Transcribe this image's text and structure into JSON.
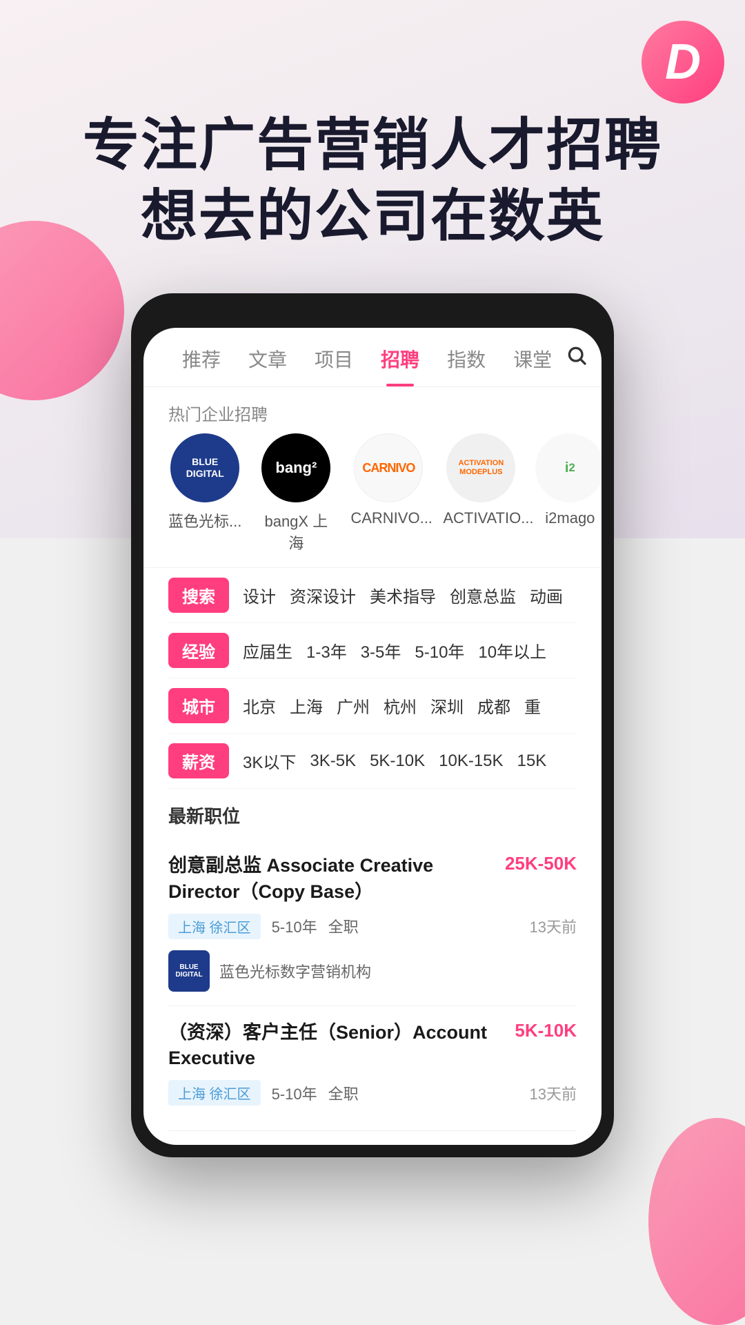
{
  "app": {
    "logo_letter": "D",
    "hero_title_line1": "专注广告营销人才招聘",
    "hero_title_line2": "想去的公司在数英"
  },
  "nav": {
    "items": [
      {
        "id": "recommend",
        "label": "推荐",
        "active": false
      },
      {
        "id": "article",
        "label": "文章",
        "active": false
      },
      {
        "id": "project",
        "label": "项目",
        "active": false
      },
      {
        "id": "recruit",
        "label": "招聘",
        "active": true
      },
      {
        "id": "index",
        "label": "指数",
        "active": false
      },
      {
        "id": "course",
        "label": "课堂",
        "active": false
      }
    ],
    "search_icon": "🔍"
  },
  "hot_companies": {
    "section_label": "热门企业招聘",
    "items": [
      {
        "id": "blue-digital",
        "name": "蓝色光标...",
        "logo_text": "BLUE\nDIGITAL",
        "bg": "#1e3a8a",
        "color": "#fff"
      },
      {
        "id": "bangx",
        "name": "bangX 上海",
        "logo_text": "bang²",
        "bg": "#000",
        "color": "#fff"
      },
      {
        "id": "carnivo",
        "name": "CARNIVO...",
        "logo_text": "CARNIVO",
        "bg": "#fff8f5",
        "color": "#ff6600"
      },
      {
        "id": "activation",
        "name": "ACTIVATIO...",
        "logo_text": "ACTIVATION\nMODEPLUS",
        "bg": "#f0f0f0",
        "color": "#ff6600"
      },
      {
        "id": "i2mago",
        "name": "i2mago",
        "logo_text": "i²",
        "bg": "#f8f8f8",
        "color": "#4CAF50"
      }
    ]
  },
  "filters": [
    {
      "tag": "搜索",
      "options": [
        "设计",
        "资深设计",
        "美术指导",
        "创意总监",
        "动画"
      ]
    },
    {
      "tag": "经验",
      "options": [
        "应届生",
        "1-3年",
        "3-5年",
        "5-10年",
        "10年以上"
      ]
    },
    {
      "tag": "城市",
      "options": [
        "北京",
        "上海",
        "广州",
        "杭州",
        "深圳",
        "成都",
        "重"
      ]
    },
    {
      "tag": "薪资",
      "options": [
        "3K以下",
        "3K-5K",
        "5K-10K",
        "10K-15K",
        "15K"
      ]
    }
  ],
  "jobs": {
    "section_label": "最新职位",
    "items": [
      {
        "id": "job1",
        "title": "创意副总监 Associate Creative Director（Copy Base）",
        "salary": "25K-50K",
        "location": "上海 徐汇区",
        "experience": "5-10年",
        "type": "全职",
        "date": "13天前",
        "company_name": "蓝色光标数字营销机构",
        "company_logo_text": "BLUE\nDIGITAL"
      },
      {
        "id": "job2",
        "title": "（资深）客户主任（Senior）Account Executive",
        "salary": "5K-10K",
        "location": "上海 徐汇区",
        "experience": "5-10年",
        "type": "全职",
        "date": "13天前",
        "company_name": "",
        "company_logo_text": ""
      }
    ]
  }
}
